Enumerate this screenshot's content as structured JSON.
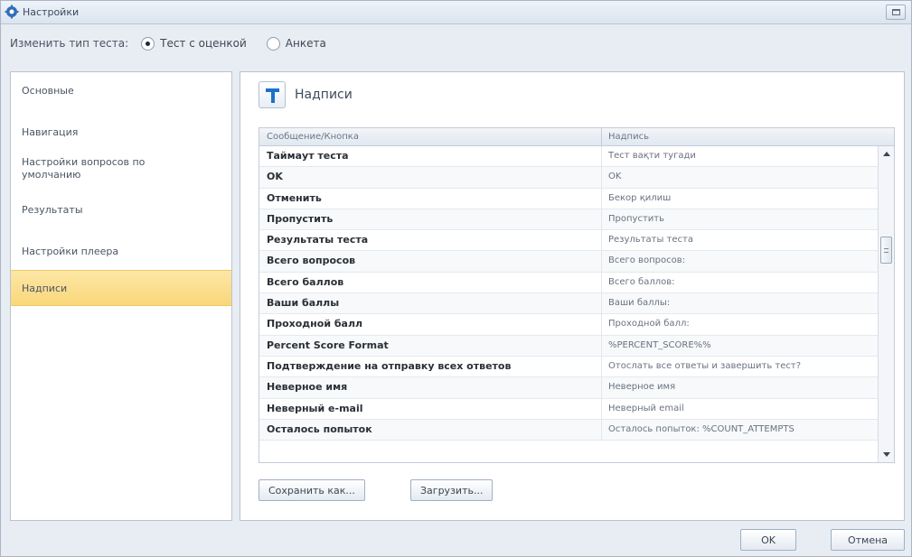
{
  "window": {
    "title": "Настройки"
  },
  "test_type": {
    "label": "Изменить тип теста:",
    "options": [
      {
        "label": "Тест с оценкой",
        "selected": true
      },
      {
        "label": "Анкета",
        "selected": false
      }
    ]
  },
  "sidebar": {
    "items": [
      {
        "label": "Основные",
        "active": false
      },
      {
        "label": "Навигация",
        "active": false
      },
      {
        "label": "Настройки вопросов по умолчанию",
        "active": false
      },
      {
        "label": "Результаты",
        "active": false
      },
      {
        "label": "Настройки плеера",
        "active": false
      },
      {
        "label": "Надписи",
        "active": true
      }
    ]
  },
  "section": {
    "title": "Надписи",
    "icon": "text-T-icon"
  },
  "table": {
    "columns": [
      "Сообщение/Кнопка",
      "Надпись"
    ],
    "rows": [
      [
        "Таймаут теста",
        "Тест вақти тугади"
      ],
      [
        "OK",
        "OK"
      ],
      [
        "Отменить",
        "Бекор қилиш"
      ],
      [
        "Пропустить",
        "Пропустить"
      ],
      [
        "Результаты теста",
        "Результаты теста"
      ],
      [
        "Всего вопросов",
        "Всего вопросов:"
      ],
      [
        "Всего баллов",
        "Всего баллов:"
      ],
      [
        "Ваши баллы",
        "Ваши баллы:"
      ],
      [
        "Проходной балл",
        "Проходной балл:"
      ],
      [
        "Percent Score Format",
        "%PERCENT_SCORE%%"
      ],
      [
        "Подтверждение на отправку всех ответов",
        "Отослать все ответы и завершить тест?"
      ],
      [
        "Неверное имя",
        "Неверное имя"
      ],
      [
        "Неверный e-mail",
        "Неверный email"
      ],
      [
        "Осталось попыток",
        "Осталось попыток: %COUNT_ATTEMPTS"
      ]
    ]
  },
  "buttons": {
    "save_as": "Сохранить как...",
    "load": "Загрузить...",
    "ok": "OK",
    "cancel": "Отмена"
  },
  "colors": {
    "accent": "#1a73c9",
    "active_item": "#f9d77a"
  }
}
